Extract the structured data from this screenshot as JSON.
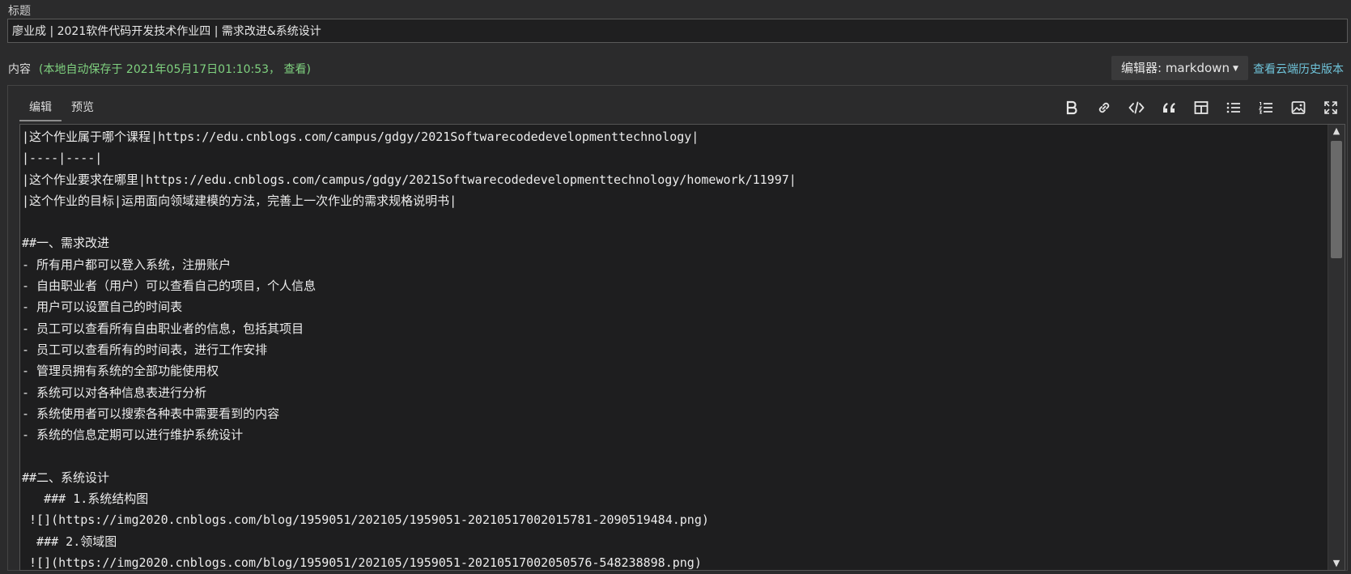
{
  "labels": {
    "title": "标题",
    "content": "内容",
    "autosave_prefix": "(本地自动保存于 2021年05月17日01:10:53，",
    "view": "查看",
    "autosave_suffix": ")"
  },
  "title_value": "廖业成 | 2021软件代码开发技术作业四 | 需求改进&系统设计",
  "editor_select": "编辑器: markdown",
  "history_link": "查看云端历史版本",
  "tabs": [
    "编辑",
    "预览"
  ],
  "toolbar_icons": [
    "bold-icon",
    "link-icon",
    "code-icon",
    "quote-icon",
    "table-icon",
    "unordered-list-icon",
    "ordered-list-icon",
    "image-icon",
    "fullscreen-icon"
  ],
  "lines": [
    "|这个作业属于哪个课程|https://edu.cnblogs.com/campus/gdgy/2021Softwarecodedevelopmenttechnology|",
    "|----|----|",
    "|这个作业要求在哪里|https://edu.cnblogs.com/campus/gdgy/2021Softwarecodedevelopmenttechnology/homework/11997|",
    "|这个作业的目标|运用面向领域建模的方法，完善上一次作业的需求规格说明书|",
    "",
    "##一、需求改进",
    "- 所有用户都可以登入系统，注册账户",
    "- 自由职业者（用户）可以查看自己的项目，个人信息",
    "- 用户可以设置自己的时间表",
    "- 员工可以查看所有自由职业者的信息，包括其项目",
    "- 员工可以查看所有的时间表，进行工作安排",
    "- 管理员拥有系统的全部功能使用权",
    "- 系统可以对各种信息表进行分析",
    "- 系统使用者可以搜索各种表中需要看到的内容",
    "- 系统的信息定期可以进行维护系统设计",
    "",
    "##二、系统设计",
    "   ### 1.系统结构图",
    " ![](https://img2020.cnblogs.com/blog/1959051/202105/1959051-20210517002015781-2090519484.png)",
    "  ### 2.领域图",
    " ![](https://img2020.cnblogs.com/blog/1959051/202105/1959051-20210517002050576-548238898.png)"
  ]
}
